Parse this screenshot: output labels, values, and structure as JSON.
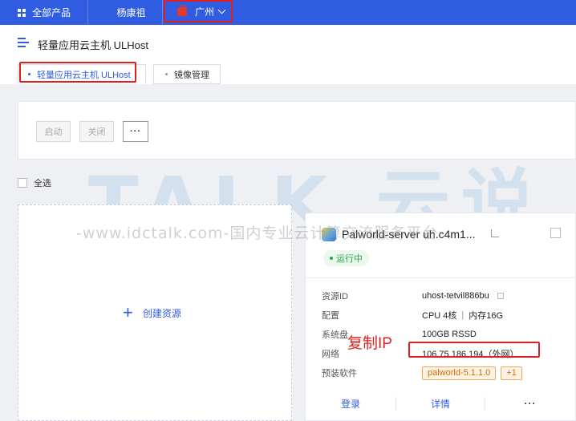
{
  "topbar": {
    "all_products": "全部产品",
    "project": "杨康祖",
    "region": "广州"
  },
  "page": {
    "title": "轻量应用云主机 ULHost",
    "tabs": [
      {
        "label": "轻量应用云主机 ULHost",
        "active": true
      },
      {
        "label": "镜像管理",
        "active": false
      }
    ]
  },
  "toolbar": {
    "start_label": "启动",
    "stop_label": "关闭",
    "more_label": "···"
  },
  "select_all_label": "全选",
  "create_label": "创建资源",
  "resource": {
    "name": "Palworld-server uh.c4m1...",
    "status": "运行中",
    "fields": {
      "id_key": "资源ID",
      "id_value": "uhost-tetvil886bu",
      "config_key": "配置",
      "cpu": "CPU 4核",
      "memory": "内存16G",
      "disk_key": "系统盘",
      "disk_value": "100GB RSSD",
      "network_key": "网络",
      "network_value": "106.75.186.194（外网）",
      "software_key": "预装软件",
      "software_tag": "palworld-5.1.1.0",
      "software_more": "+1"
    },
    "actions": {
      "login": "登录",
      "detail": "详情",
      "more": "···"
    }
  },
  "annotation_note": "复制IP",
  "watermark": {
    "logo": "TALK 云说",
    "url": "-www.idctalk.com-国内专业云计算交流服务平台-"
  },
  "colors": {
    "brand_blue": "#2f5ce0",
    "highlight_red": "#e02020",
    "status_green": "#2aa54a",
    "tag_orange": "#d46a00"
  }
}
